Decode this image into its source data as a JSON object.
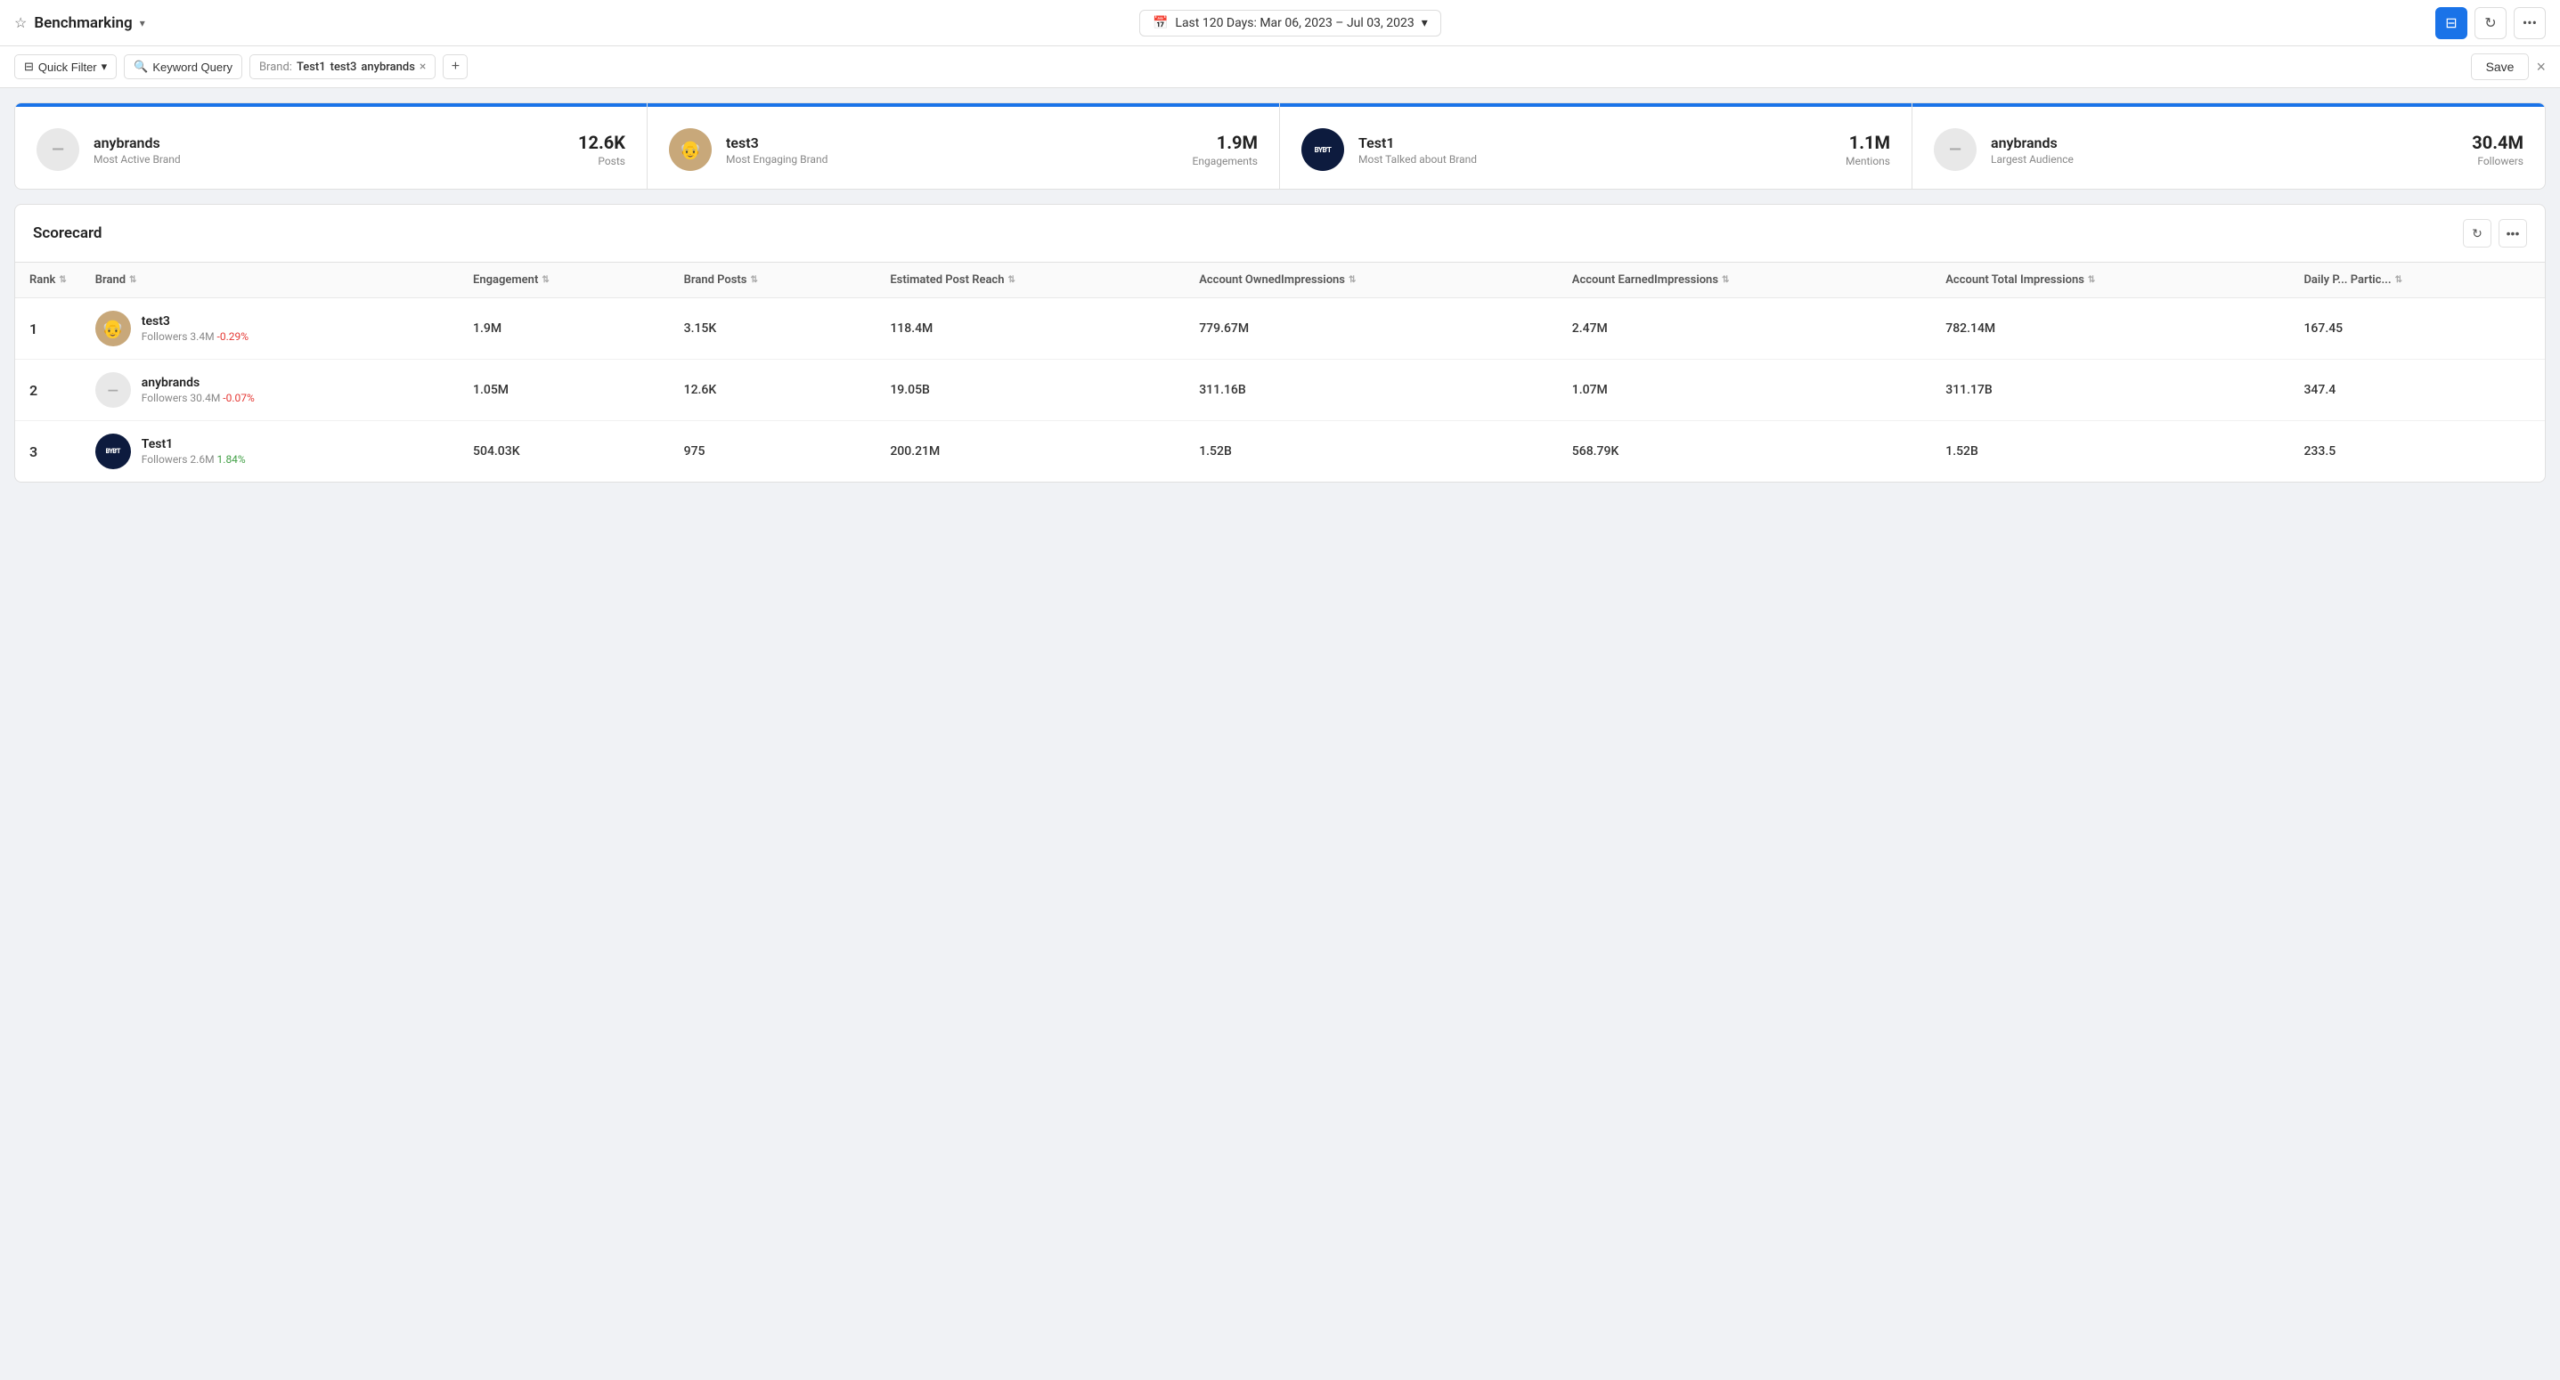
{
  "header": {
    "star_icon": "★",
    "title": "Benchmarking",
    "dropdown_icon": "▾",
    "date_range": "Last 120 Days: Mar 06, 2023 – Jul 03, 2023",
    "filter_icon": "⊟",
    "refresh_icon": "↻",
    "more_icon": "•••"
  },
  "filter_bar": {
    "quick_filter_label": "Quick Filter",
    "keyword_label": "Keyword Query",
    "brand_label": "Brand:",
    "brand_tags": [
      "Test1",
      "test3",
      "anybrands"
    ],
    "add_icon": "+",
    "save_label": "Save",
    "close_icon": "×"
  },
  "summary_cards": [
    {
      "brand_name": "anybrands",
      "subtitle": "Most Active Brand",
      "value": "12.6K",
      "metric": "Posts",
      "color": "#1a73e8",
      "avatar_type": "anybrands"
    },
    {
      "brand_name": "test3",
      "subtitle": "Most Engaging Brand",
      "value": "1.9M",
      "metric": "Engagements",
      "color": "#1a73e8",
      "avatar_type": "test3"
    },
    {
      "brand_name": "Test1",
      "subtitle": "Most Talked about Brand",
      "value": "1.1M",
      "metric": "Mentions",
      "color": "#1a73e8",
      "avatar_type": "test1"
    },
    {
      "brand_name": "anybrands",
      "subtitle": "Largest Audience",
      "value": "30.4M",
      "metric": "Followers",
      "color": "#1a73e8",
      "avatar_type": "anybrands"
    }
  ],
  "scorecard": {
    "title": "Scorecard",
    "columns": [
      {
        "label": "Rank",
        "key": "rank",
        "sortable": true
      },
      {
        "label": "Brand",
        "key": "brand",
        "sortable": true
      },
      {
        "label": "Engagement",
        "key": "engagement",
        "sortable": true
      },
      {
        "label": "Brand Posts",
        "key": "brand_posts",
        "sortable": true
      },
      {
        "label": "Estimated Post Reach",
        "key": "est_post_reach",
        "sortable": true
      },
      {
        "label": "Account OwnedImpressions",
        "key": "owned_impressions",
        "sortable": true
      },
      {
        "label": "Account EarnedImpressions",
        "key": "earned_impressions",
        "sortable": true
      },
      {
        "label": "Account Total Impressions",
        "key": "total_impressions",
        "sortable": true
      },
      {
        "label": "Daily P... Partic...",
        "key": "daily_partic",
        "sortable": true
      }
    ],
    "rows": [
      {
        "rank": "1",
        "brand_name": "test3",
        "brand_followers": "Followers  3.4M",
        "brand_change": "-0.29%",
        "brand_change_type": "negative",
        "engagement": "1.9M",
        "brand_posts": "3.15K",
        "est_post_reach": "118.4M",
        "owned_impressions": "779.67M",
        "earned_impressions": "2.47M",
        "total_impressions": "782.14M",
        "daily_partic": "167.45",
        "avatar_type": "test3"
      },
      {
        "rank": "2",
        "brand_name": "anybrands",
        "brand_followers": "Followers  30.4M",
        "brand_change": "-0.07%",
        "brand_change_type": "negative",
        "engagement": "1.05M",
        "brand_posts": "12.6K",
        "est_post_reach": "19.05B",
        "owned_impressions": "311.16B",
        "earned_impressions": "1.07M",
        "total_impressions": "311.17B",
        "daily_partic": "347.4",
        "avatar_type": "anybrands"
      },
      {
        "rank": "3",
        "brand_name": "Test1",
        "brand_followers": "Followers  2.6M",
        "brand_change": "1.84%",
        "brand_change_type": "positive",
        "engagement": "504.03K",
        "brand_posts": "975",
        "est_post_reach": "200.21M",
        "owned_impressions": "1.52B",
        "earned_impressions": "568.79K",
        "total_impressions": "1.52B",
        "daily_partic": "233.5",
        "avatar_type": "test1"
      }
    ]
  }
}
